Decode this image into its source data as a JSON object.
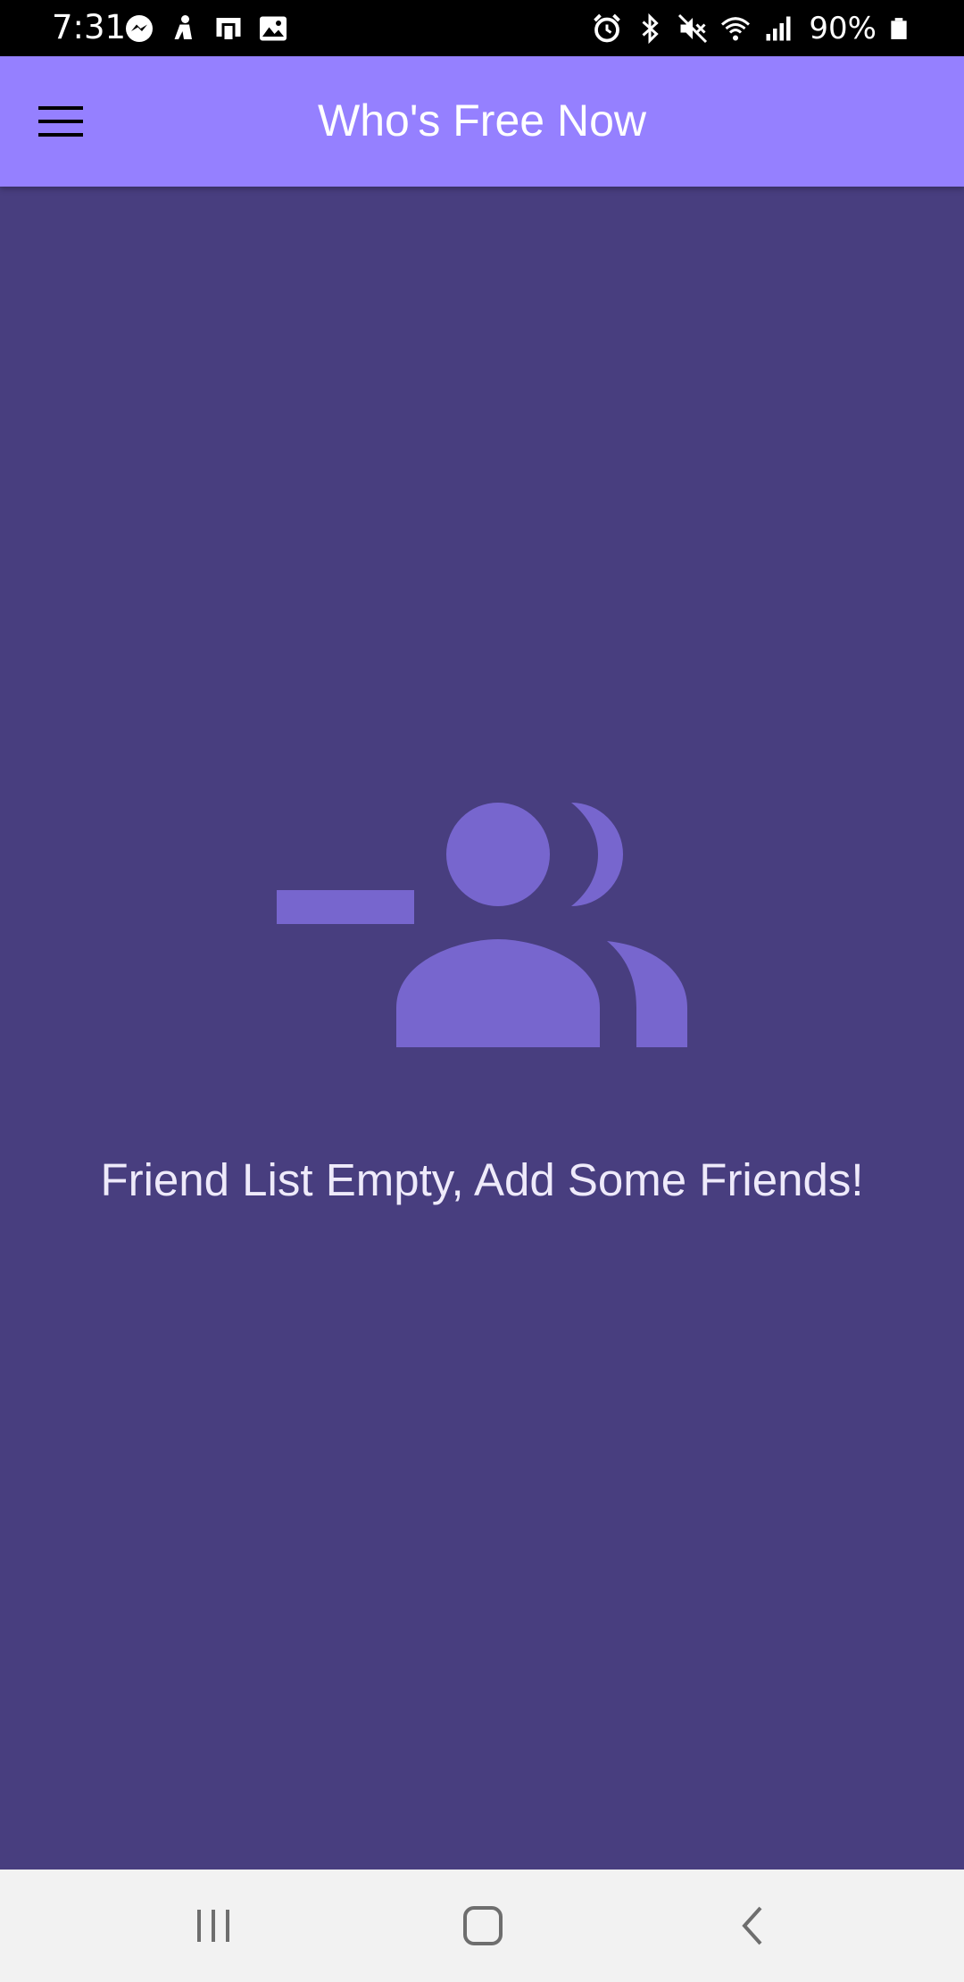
{
  "status_bar": {
    "time": "7:31",
    "battery_percent": "90%",
    "left_icons": [
      "messenger-icon",
      "notification-icon",
      "clipboard-icon",
      "gallery-icon"
    ],
    "right_icons": [
      "alarm-icon",
      "bluetooth-icon",
      "mute-icon",
      "wifi-icon",
      "signal-icon",
      "battery-icon"
    ]
  },
  "app_bar": {
    "title": "Who's Free Now",
    "menu_icon": "hamburger-menu-icon",
    "background_color": "#9580FF"
  },
  "empty_state": {
    "icon": "remove-friends-icon",
    "message": "Friend List Empty, Add Some Friends!",
    "background_color": "#483E7F",
    "icon_color": "#7766CE"
  },
  "nav_bar": {
    "buttons": [
      "recents-icon",
      "home-icon",
      "back-icon"
    ]
  }
}
